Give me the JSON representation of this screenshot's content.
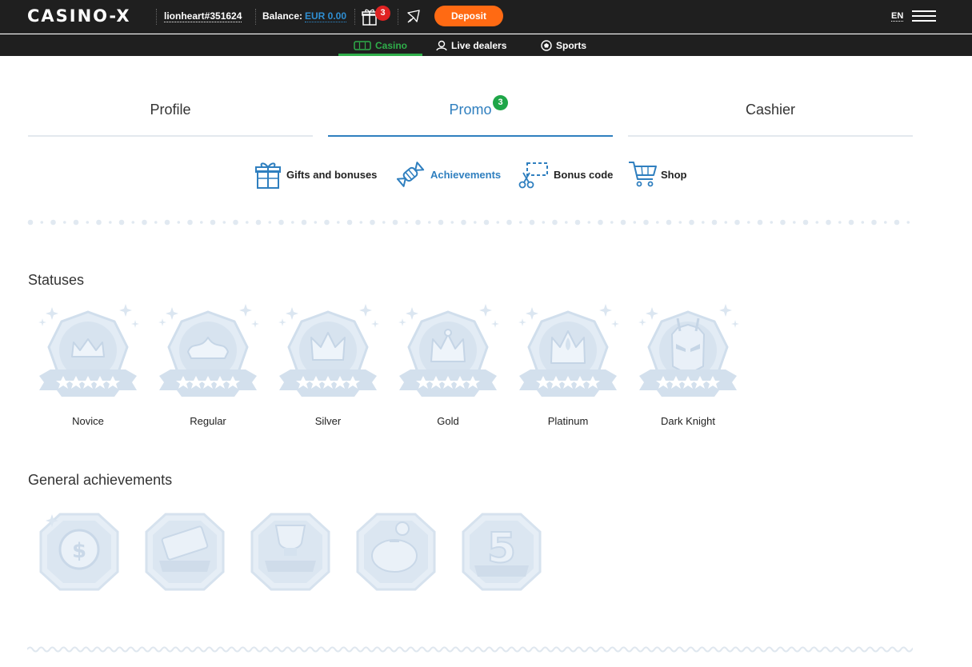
{
  "header": {
    "logo": "CASINO-X",
    "username": "lionheart#351624",
    "balance_label": "Balance:",
    "balance_value": "EUR 0.00",
    "gift_count": "3",
    "deposit_label": "Deposit",
    "language": "EN"
  },
  "subnav": [
    {
      "label": "Casino",
      "icon": "slot-icon",
      "active": true
    },
    {
      "label": "Live dealers",
      "icon": "dealer-icon",
      "active": false
    },
    {
      "label": "Sports",
      "icon": "ball-icon",
      "active": false
    }
  ],
  "tabs": [
    {
      "label": "Profile",
      "active": false
    },
    {
      "label": "Promo",
      "active": true,
      "badge": "3"
    },
    {
      "label": "Cashier",
      "active": false
    }
  ],
  "subtabs": [
    {
      "label": "Gifts and bonuses",
      "icon": "gift-icon",
      "active": false
    },
    {
      "label": "Achievements",
      "icon": "candy-icon",
      "active": true
    },
    {
      "label": "Bonus code",
      "icon": "scissors-icon",
      "active": false
    },
    {
      "label": "Shop",
      "icon": "cart-icon",
      "active": false
    }
  ],
  "sections": {
    "statuses_title": "Statuses",
    "achievements_title": "General achievements"
  },
  "statuses": [
    {
      "label": "Novice",
      "emblem": "crown-small"
    },
    {
      "label": "Regular",
      "emblem": "crown-wide"
    },
    {
      "label": "Silver",
      "emblem": "crown-peaked"
    },
    {
      "label": "Gold",
      "emblem": "crown-jewel"
    },
    {
      "label": "Platinum",
      "emblem": "crown-flame"
    },
    {
      "label": "Dark Knight",
      "emblem": "knight-helmet"
    }
  ],
  "achievements": [
    {
      "name": "coin-achievement"
    },
    {
      "name": "lottery-winner-achievement"
    },
    {
      "name": "cup-winner-achievement"
    },
    {
      "name": "piggy-bank-achievement"
    },
    {
      "name": "combo-5-achievement"
    }
  ],
  "colors": {
    "accent": "#2f7fbf",
    "active_nav": "#2fae4a",
    "deposit": "#ff6a13",
    "badge_red": "#e02222",
    "badge_green": "#1fa648",
    "locked_badge": "#dbe6f1"
  }
}
